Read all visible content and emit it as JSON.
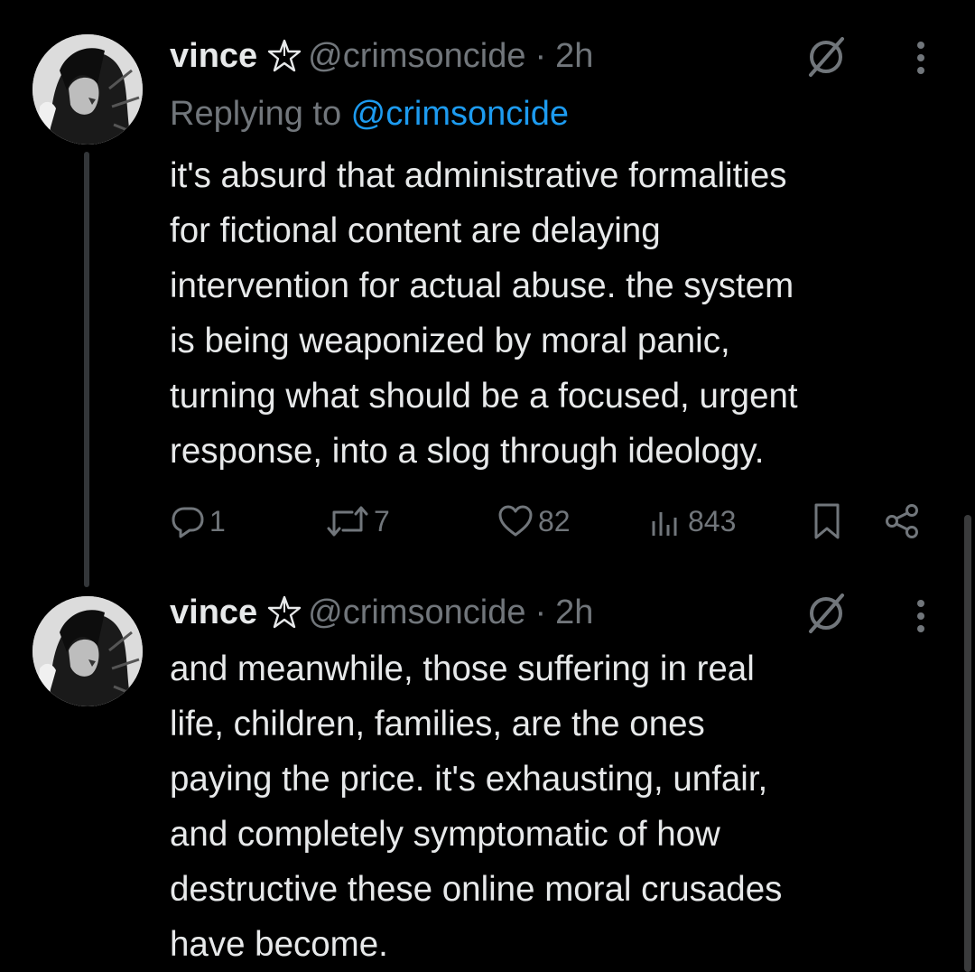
{
  "tweets": [
    {
      "author_name": "vince",
      "author_handle": "@crimsoncide",
      "separator": "·",
      "time": "2h",
      "replying_prefix": "Replying to ",
      "replying_to": "@crimsoncide",
      "lines": [
        "it's absurd that administrative formalities",
        "for fictional content are delaying",
        "intervention for actual abuse. the system",
        "is being weaponized by moral panic,",
        "turning what should be a focused, urgent",
        "response, into a slog through ideology."
      ],
      "actions": {
        "replies": "1",
        "reposts": "7",
        "likes": "82",
        "views": "843"
      }
    },
    {
      "author_name": "vince",
      "author_handle": "@crimsoncide",
      "separator": "·",
      "time": "2h",
      "lines": [
        "and meanwhile, those suffering in real",
        "life, children, families, are the ones",
        "paying the price. it's exhausting, unfair,",
        "and completely symptomatic of how",
        "destructive these online moral crusades",
        "have become."
      ]
    }
  ],
  "icons": {
    "name_badge": "pentagram-icon",
    "top_right": "no-sign-icon",
    "menu": "more-vertical-icon",
    "reply": "reply-icon",
    "repost": "repost-icon",
    "like": "heart-icon",
    "views": "views-icon",
    "bookmark": "bookmark-icon",
    "share": "share-icon"
  },
  "colors": {
    "background": "#000000",
    "text": "#e7e9ea",
    "muted": "#71767b",
    "link": "#1d9bf0"
  }
}
